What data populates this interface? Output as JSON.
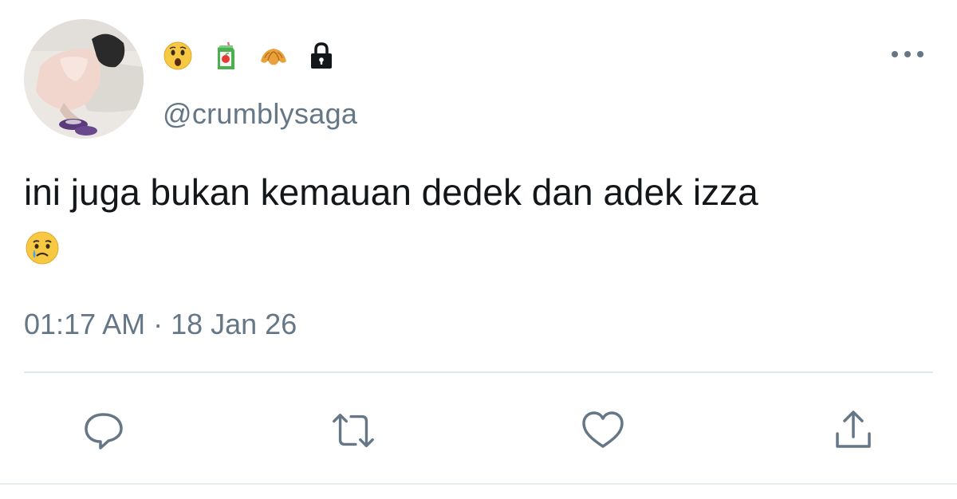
{
  "user": {
    "handle": "@crumblysaga",
    "avatar": "profile-photo",
    "name_emojis": [
      "hushed-face-emoji",
      "juice-box-emoji",
      "croissant-emoji",
      "lock-icon"
    ]
  },
  "tweet": {
    "text": "ini juga bukan kemauan dedek dan adek izza",
    "trailing_emoji": "crying-face-emoji",
    "timestamp": "01:17 AM · 18 Jan 26"
  },
  "actions": [
    "reply-icon",
    "retweet-icon",
    "like-icon",
    "share-icon"
  ],
  "colors": {
    "text": "#14171a",
    "secondary": "#657786",
    "divider": "#e1e8ed"
  }
}
